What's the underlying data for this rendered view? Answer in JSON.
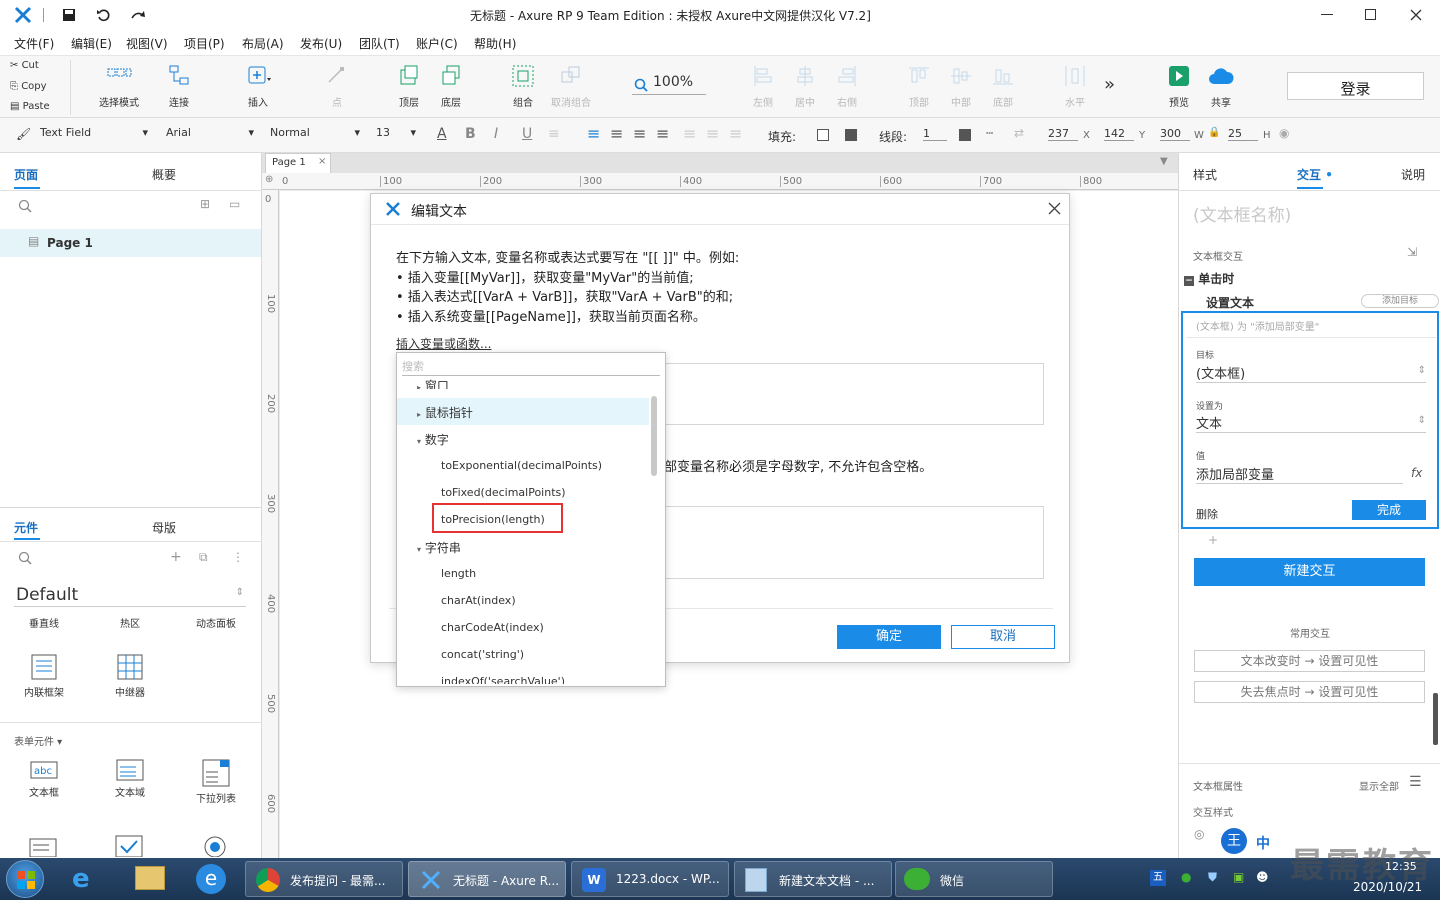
{
  "title_bar": {
    "text": "无标题 - Axure RP 9 Team Edition : 未授权     Axure中文网提供汉化 V7.2]"
  },
  "menu": [
    "文件(F)",
    "编辑(E)",
    "视图(V)",
    "项目(P)",
    "布局(A)",
    "发布(U)",
    "团队(T)",
    "账户(C)",
    "帮助(H)"
  ],
  "clipboard": {
    "cut": "Cut",
    "copy": "Copy",
    "paste": "Paste"
  },
  "toolbar": {
    "select_mode": "选择模式",
    "connect": "连接",
    "insert": "插入",
    "point": "点",
    "top_layer": "顶层",
    "bottom_layer": "底层",
    "group": "组合",
    "ungroup": "取消组合",
    "zoom": "100%",
    "align_left": "左侧",
    "align_center": "居中",
    "align_right": "右侧",
    "align_top": "顶部",
    "align_middle": "中部",
    "align_bottom": "底部",
    "distribute_h": "水平",
    "more": "»",
    "preview": "预览",
    "share": "共享",
    "login": "登录"
  },
  "format": {
    "widget_type": "Text Field",
    "font": "Arial",
    "style": "Normal",
    "size": "13",
    "fill_label": "填充:",
    "line_label": "线段:",
    "line_width": "1",
    "x": "237",
    "x_l": "X",
    "y": "142",
    "y_l": "Y",
    "w": "300",
    "w_l": "W",
    "h": "25",
    "h_l": "H"
  },
  "left": {
    "tab_pages": "页面",
    "tab_outline": "概要",
    "page1": "Page 1",
    "tab_widgets": "元件",
    "tab_masters": "母版",
    "library": "Default",
    "widgets_row1": [
      "垂直线",
      "热区",
      "动态面板"
    ],
    "widgets_row2": [
      "内联框架",
      "中继器"
    ],
    "form_section": "表单元件 ▾",
    "widgets_row3": [
      "文本框",
      "文本域",
      "下拉列表"
    ]
  },
  "canvas": {
    "page_tab": "Page 1",
    "ruler_h": [
      "0",
      "100",
      "200",
      "300",
      "400",
      "500",
      "600",
      "700",
      "800"
    ],
    "ruler_v": [
      "0",
      "100",
      "200",
      "300",
      "400",
      "500",
      "600"
    ]
  },
  "dialog": {
    "title": "编辑文本",
    "intro": [
      "在下方输入文本, 变量名称或表达式要写在 \"[[ ]]\" 中。例如:",
      "• 插入变量[[MyVar]]，获取变量\"MyVar\"的当前值;",
      "• 插入表达式[[VarA + VarB]]，获取\"VarA + VarB\"的和;",
      "• 插入系统变量[[PageName]]，获取当前页面名称。"
    ],
    "insert_link": "插入变量或函数...",
    "local_var_note": "部变量名称必须是字母数字, 不允许包含空格。",
    "ok": "确定",
    "cancel": "取消"
  },
  "popup": {
    "search_placeholder": "搜索",
    "items": [
      {
        "label": "窗口",
        "kind": "group"
      },
      {
        "label": "鼠标指针",
        "kind": "group"
      },
      {
        "label": "数字",
        "kind": "open"
      },
      {
        "label": "toExponential(decimalPoints)",
        "kind": "fn"
      },
      {
        "label": "toFixed(decimalPoints)",
        "kind": "fn"
      },
      {
        "label": "toPrecision(length)",
        "kind": "fn"
      },
      {
        "label": "字符串",
        "kind": "open"
      },
      {
        "label": "length",
        "kind": "fn"
      },
      {
        "label": "charAt(index)",
        "kind": "fn"
      },
      {
        "label": "charCodeAt(index)",
        "kind": "fn"
      },
      {
        "label": "concat('string')",
        "kind": "fn"
      },
      {
        "label": "indexOf('searchValue')",
        "kind": "fn"
      }
    ]
  },
  "right": {
    "tab_style": "样式",
    "tab_interact": "交互",
    "tab_notes": "说明",
    "name_placeholder": "(文本框名称)",
    "section": "文本框交互",
    "event": "单击时",
    "action": "设置文本",
    "add_target": "添加目标",
    "summary": "(文本框) 为 \"添加局部变量\"",
    "target_label": "目标",
    "target_value": "(文本框)",
    "setto_label": "设置为",
    "setto_value": "文本",
    "value_label": "值",
    "value_value": "添加局部变量",
    "fx": "fx",
    "delete": "删除",
    "done": "完成",
    "plus": "+",
    "new_interaction": "新建交互",
    "common": "常用交互",
    "common1": "文本改变时 → 设置可见性",
    "common2": "失去焦点时 → 设置可见性",
    "props": "文本框属性",
    "show_all": "显示全部",
    "interact_style": "交互样式"
  },
  "taskbar": {
    "tasks": [
      "发布提问 - 最需...",
      "无标题 - Axure R...",
      "1223.docx - WP...",
      "新建文本文档 - ...",
      "微信"
    ],
    "time": "12:35",
    "date": "2020/10/21",
    "watermark": "最需教育",
    "ime": "中"
  }
}
